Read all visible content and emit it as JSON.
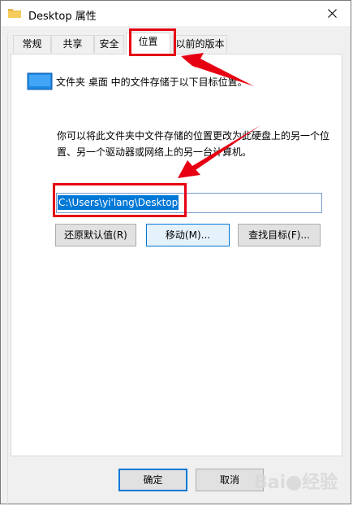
{
  "window": {
    "title": "Desktop 属性",
    "close_glyph": "✕"
  },
  "tabs": [
    {
      "label": "常规"
    },
    {
      "label": "共享"
    },
    {
      "label": "安全"
    },
    {
      "label": "位置"
    },
    {
      "label": "以前的版本"
    }
  ],
  "active_tab": "位置",
  "location": {
    "current_text": "文件夹 桌面 中的文件存储于以下目标位置。",
    "description": "你可以将此文件夹中文件存储的位置更改为此硬盘上的另一个位置、另一个驱动器或网络上的另一台计算机。",
    "path_value": "C:\\Users\\yi'lang\\Desktop"
  },
  "buttons": {
    "restore_default": "还原默认值(R)",
    "move": "移动(M)...",
    "find_target": "查找目标(F)...",
    "ok": "确定",
    "cancel": "取消"
  },
  "watermark": {
    "text_left": "Bai",
    "text_right": "经验"
  },
  "colors": {
    "accent": "#0078d7",
    "annotation": "#e60012",
    "folder_icon": "#1e88e5"
  }
}
